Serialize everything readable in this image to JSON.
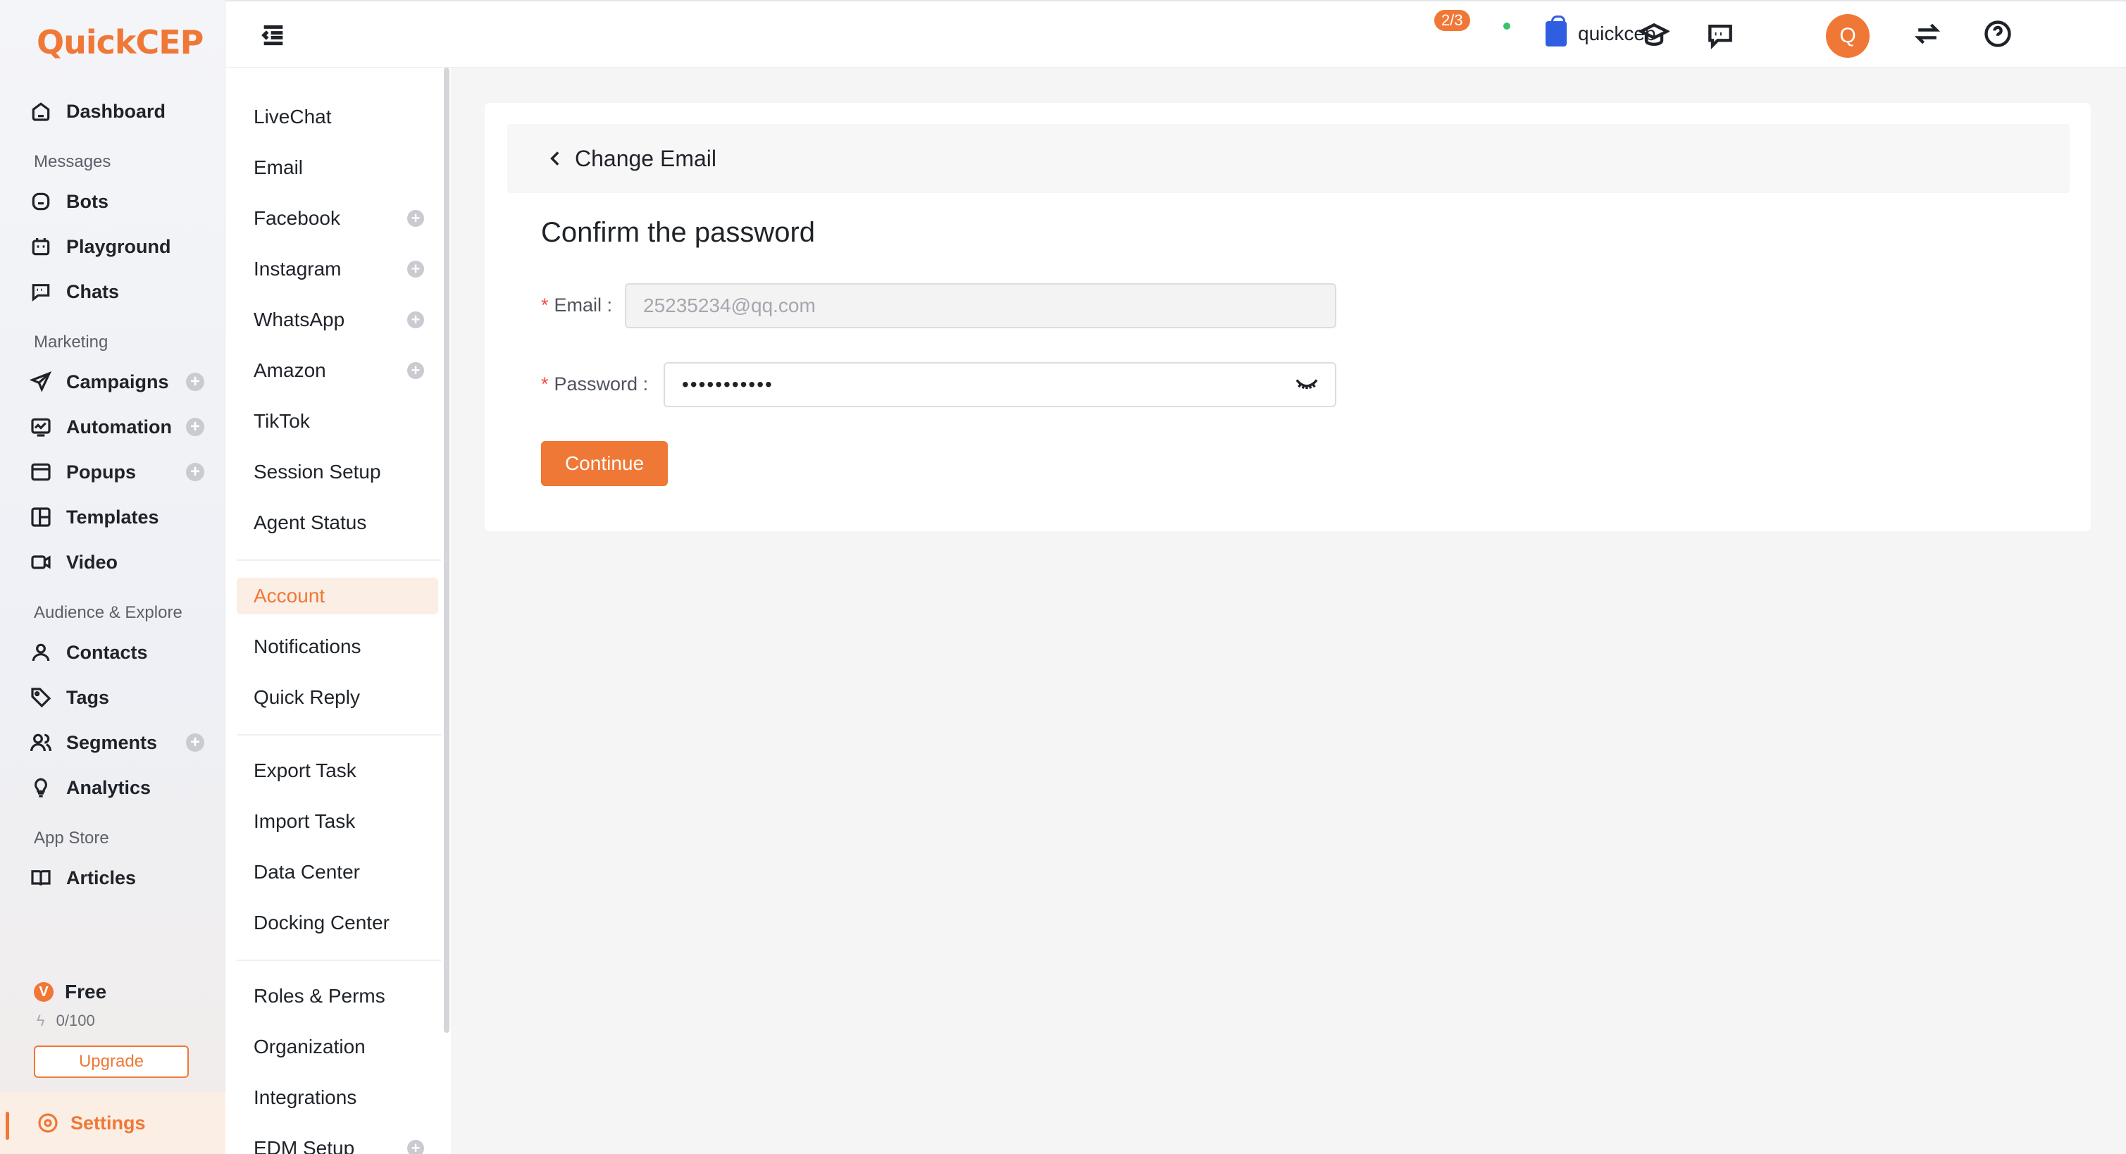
{
  "app": {
    "logo_q": "Q",
    "logo_mid": "uick",
    "logo_cep": "CEP"
  },
  "sidebar": {
    "dashboard": "Dashboard",
    "sections": {
      "messages": "Messages",
      "marketing": "Marketing",
      "audience": "Audience & Explore",
      "appstore": "App Store"
    },
    "items": {
      "bots": "Bots",
      "playground": "Playground",
      "chats": "Chats",
      "campaigns": "Campaigns",
      "automation": "Automation",
      "popups": "Popups",
      "templates": "Templates",
      "video": "Video",
      "contacts": "Contacts",
      "tags": "Tags",
      "segments": "Segments",
      "analytics": "Analytics",
      "articles": "Articles"
    },
    "plan": {
      "name": "Free",
      "badge": "V",
      "usage": "0/100",
      "upgrade": "Upgrade"
    },
    "settings": "Settings"
  },
  "header": {
    "onboarding_badge": "2/3",
    "shop_name": "quickcep",
    "avatar_letter": "Q"
  },
  "subnav": {
    "livechat": "LiveChat",
    "email": "Email",
    "facebook": "Facebook",
    "instagram": "Instagram",
    "whatsapp": "WhatsApp",
    "amazon": "Amazon",
    "tiktok": "TikTok",
    "session_setup": "Session Setup",
    "agent_status": "Agent Status",
    "account": "Account",
    "notifications": "Notifications",
    "quick_reply": "Quick Reply",
    "export_task": "Export Task",
    "import_task": "Import Task",
    "data_center": "Data Center",
    "docking_center": "Docking Center",
    "roles_perms": "Roles & Perms",
    "organization": "Organization",
    "integrations": "Integrations",
    "edm_setup": "EDM Setup"
  },
  "content": {
    "back_title": "Change Email",
    "form_title": "Confirm the password",
    "email_label": "Email",
    "email_value": "25235234@qq.com",
    "password_label": "Password",
    "password_value": "•••••••••••",
    "continue": "Continue"
  }
}
